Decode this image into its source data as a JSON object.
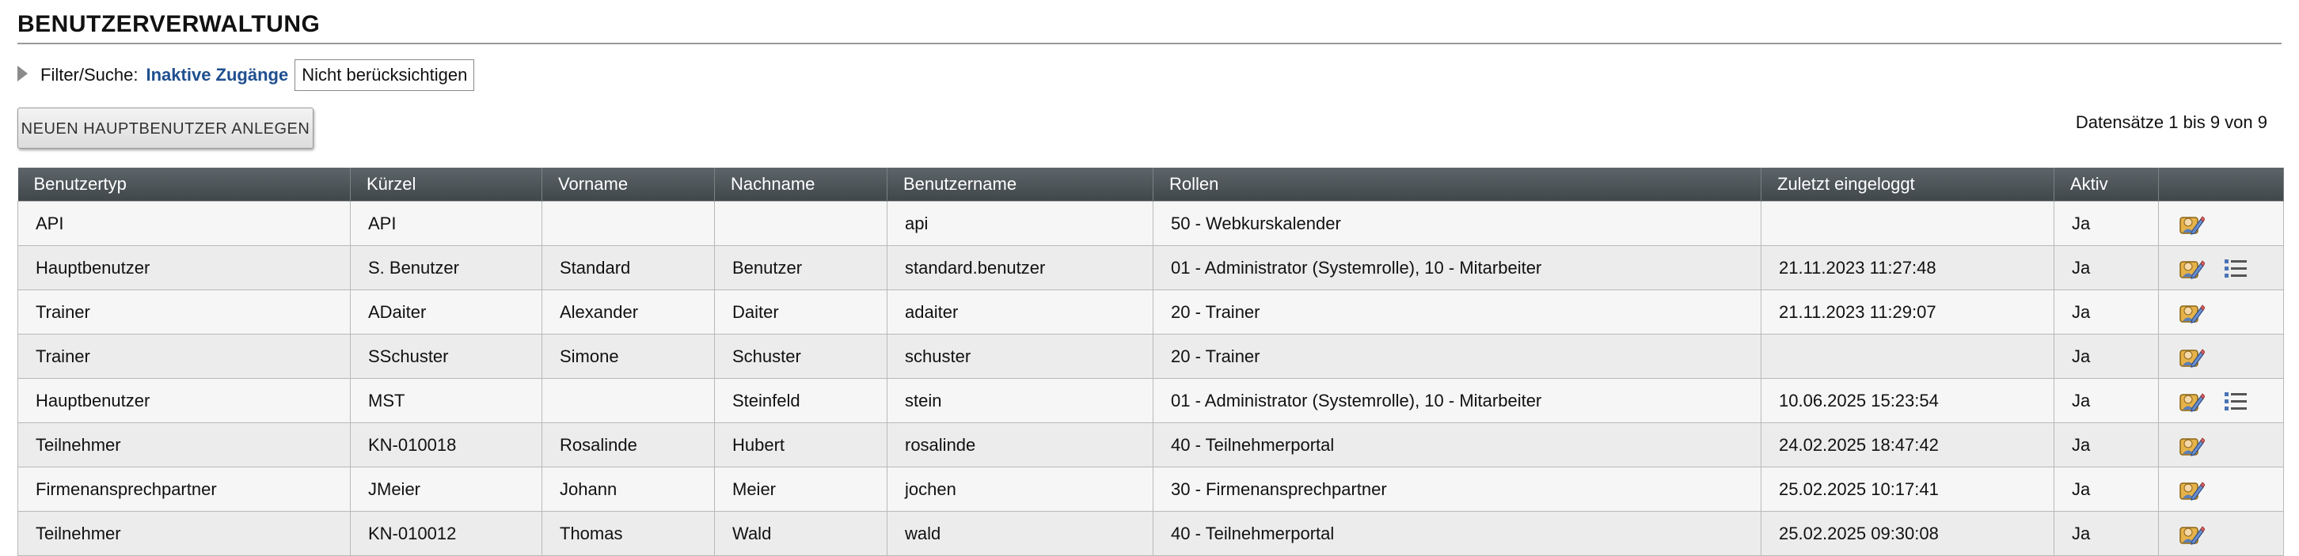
{
  "page": {
    "title": "BENUTZERVERWALTUNG"
  },
  "filter": {
    "label": "Filter/Suche:",
    "link": "Inaktive Zugänge",
    "value": "Nicht berücksichtigen"
  },
  "actions": {
    "new_main_user": "NEUEN HAUPTBENUTZER ANLEGEN"
  },
  "records_info": "Datensätze 1 bis 9 von 9",
  "table": {
    "columns": [
      "Benutzertyp",
      "Kürzel",
      "Vorname",
      "Nachname",
      "Benutzername",
      "Rollen",
      "Zuletzt eingeloggt",
      "Aktiv",
      ""
    ],
    "rows": [
      [
        "API",
        "API",
        "",
        "",
        "api",
        "50 - Webkurskalender",
        "",
        "Ja"
      ],
      [
        "Hauptbenutzer",
        "S. Benutzer",
        "Standard",
        "Benutzer",
        "standard.benutzer",
        "01 - Administrator (Systemrolle), 10 - Mitarbeiter",
        "21.11.2023 11:27:48",
        "Ja"
      ],
      [
        "Trainer",
        "ADaiter",
        "Alexander",
        "Daiter",
        "adaiter",
        "20 - Trainer",
        "21.11.2023 11:29:07",
        "Ja"
      ],
      [
        "Trainer",
        "SSchuster",
        "Simone",
        "Schuster",
        "schuster",
        "20 - Trainer",
        "",
        "Ja"
      ],
      [
        "Hauptbenutzer",
        "MST",
        "",
        "Steinfeld",
        "stein",
        "01 - Administrator (Systemrolle), 10 - Mitarbeiter",
        "10.06.2025 15:23:54",
        "Ja"
      ],
      [
        "Teilnehmer",
        "KN-010018",
        "Rosalinde",
        "Hubert",
        "rosalinde",
        "40 - Teilnehmerportal",
        "24.02.2025 18:47:42",
        "Ja"
      ],
      [
        "Firmenansprechpartner",
        "JMeier",
        "Johann",
        "Meier",
        "jochen",
        "30 - Firmenansprechpartner",
        "25.02.2025 10:17:41",
        "Ja"
      ],
      [
        "Teilnehmer",
        "KN-010012",
        "Thomas",
        "Wald",
        "wald",
        "40 - Teilnehmerportal",
        "25.02.2025 09:30:08",
        "Ja"
      ]
    ],
    "row_actions": [
      [
        "edit-user-icon"
      ],
      [
        "edit-user-icon",
        "list-icon"
      ],
      [
        "edit-user-icon"
      ],
      [
        "edit-user-icon"
      ],
      [
        "edit-user-icon",
        "list-icon"
      ],
      [
        "edit-user-icon"
      ],
      [
        "edit-user-icon"
      ],
      [
        "edit-user-icon"
      ]
    ]
  }
}
